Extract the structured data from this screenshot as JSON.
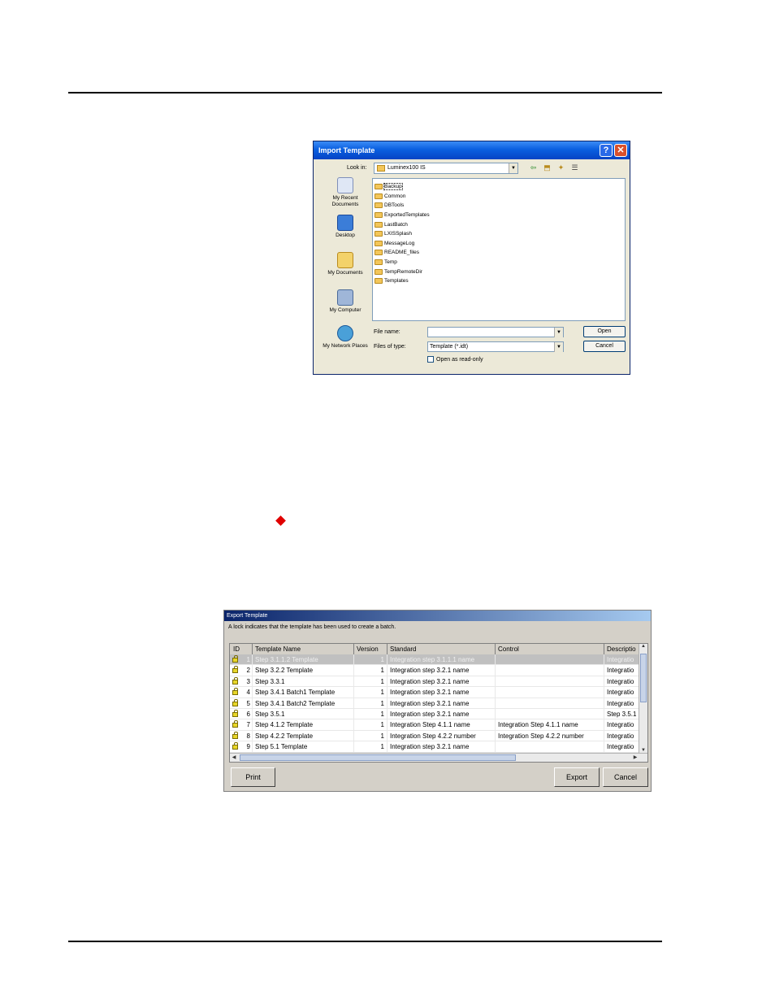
{
  "import_dialog": {
    "title": "Import Template",
    "help_glyph": "?",
    "close_glyph": "✕",
    "look_in_label": "Look in:",
    "look_in_value": "Luminex100 IS",
    "places": [
      {
        "label": "My Recent Documents",
        "icon": "recent-documents-icon"
      },
      {
        "label": "Desktop",
        "icon": "desktop-icon"
      },
      {
        "label": "My Documents",
        "icon": "my-documents-icon"
      },
      {
        "label": "My Computer",
        "icon": "my-computer-icon"
      },
      {
        "label": "My Network Places",
        "icon": "network-places-icon"
      }
    ],
    "folders": [
      "Backup",
      "Common",
      "DBTools",
      "ExportedTemplates",
      "LastBatch",
      "LXISSplash",
      "MessageLog",
      "README_files",
      "Temp",
      "TempRemoteDir",
      "Templates"
    ],
    "file_name_label": "File name:",
    "file_name_value": "",
    "files_of_type_label": "Files of type:",
    "files_of_type_value": "Template (*.idt)",
    "read_only_label": "Open as read-only",
    "open_button": "Open",
    "cancel_button": "Cancel"
  },
  "export_dialog": {
    "title": "Export Template",
    "note": "A lock indicates that the template has been used to create a batch.",
    "columns": [
      "ID",
      "Template Name",
      "Version",
      "Standard",
      "Control",
      "Descriptio"
    ],
    "rows": [
      {
        "id": "1",
        "name": "Step 3.1.1.2 Template",
        "version": "1",
        "standard": "Integration step 3.1.1.1 name",
        "control": "",
        "description": "Integratio"
      },
      {
        "id": "2",
        "name": "Step 3.2.2 Template",
        "version": "1",
        "standard": "Integration step 3.2.1 name",
        "control": "",
        "description": "Integratio"
      },
      {
        "id": "3",
        "name": "Step 3.3.1",
        "version": "1",
        "standard": "Integration step 3.2.1 name",
        "control": "",
        "description": "Integratio"
      },
      {
        "id": "4",
        "name": "Step 3.4.1 Batch1 Template",
        "version": "1",
        "standard": "Integration step 3.2.1 name",
        "control": "",
        "description": "Integratio"
      },
      {
        "id": "5",
        "name": "Step 3.4.1 Batch2 Template",
        "version": "1",
        "standard": "Integration step 3.2.1 name",
        "control": "",
        "description": "Integratio"
      },
      {
        "id": "6",
        "name": "Step 3.5.1",
        "version": "1",
        "standard": "Integration step 3.2.1 name",
        "control": "",
        "description": "Step 3.5.1"
      },
      {
        "id": "7",
        "name": "Step 4.1.2 Template",
        "version": "1",
        "standard": "Integration Step 4.1.1 name",
        "control": "Integration Step 4.1.1 name",
        "description": "Integratio"
      },
      {
        "id": "8",
        "name": "Step 4.2.2 Template",
        "version": "1",
        "standard": "Integration Step 4.2.2 number",
        "control": "Integration Step 4.2.2 number",
        "description": "Integratio"
      },
      {
        "id": "9",
        "name": "Step 5.1 Template",
        "version": "1",
        "standard": "Integration step 3.2.1 name",
        "control": "",
        "description": "Integratio"
      }
    ],
    "print_button": "Print",
    "export_button": "Export",
    "cancel_button": "Cancel"
  },
  "colors": {
    "accent_blue": "#0a5fe0",
    "bullet_red": "#e00000"
  }
}
